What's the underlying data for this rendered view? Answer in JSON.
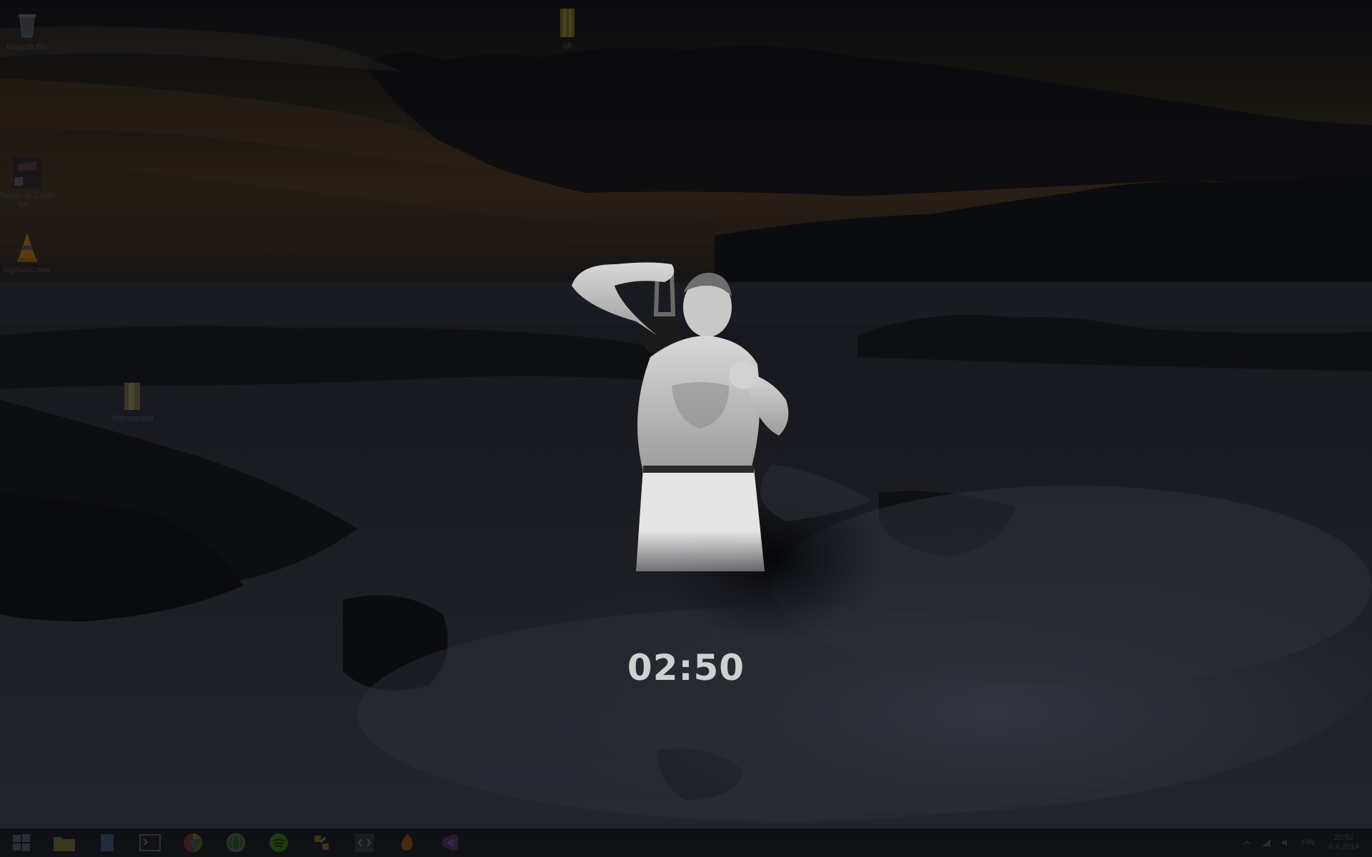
{
  "desktop": {
    "icons": [
      {
        "label": "Recycle Bin",
        "icon": "recycle-bin-icon"
      },
      {
        "label": "git",
        "icon": "folder-icon"
      },
      {
        "label": "Return to Castle Wo...",
        "icon": "game-shortcut-icon"
      },
      {
        "label": "bigmusic.wav",
        "icon": "vlc-icon"
      },
      {
        "label": "Rampanted",
        "icon": "folder-icon"
      }
    ]
  },
  "timer": {
    "value": "02:50"
  },
  "taskbar": {
    "apps": [
      {
        "name": "start",
        "icon": "windows-start-icon"
      },
      {
        "name": "file-explorer",
        "icon": "folder-icon"
      },
      {
        "name": "app-2",
        "icon": "document-icon"
      },
      {
        "name": "terminal",
        "icon": "terminal-icon"
      },
      {
        "name": "chrome",
        "icon": "chrome-icon"
      },
      {
        "name": "app-5",
        "icon": "globe-icon"
      },
      {
        "name": "spotify",
        "icon": "spotify-icon"
      },
      {
        "name": "app-7",
        "icon": "tools-icon"
      },
      {
        "name": "code-editor",
        "icon": "code-icon"
      },
      {
        "name": "app-9",
        "icon": "fire-icon"
      },
      {
        "name": "visual-studio",
        "icon": "visual-studio-icon"
      }
    ],
    "tray": {
      "language": "FIN",
      "time": "20:52",
      "date": "6.4.2014"
    }
  },
  "colors": {
    "timer_text": "#cfd0d2",
    "sky_dark": "#0c0d12",
    "sky_glow": "#3a2a1a",
    "water": "#1a1c22"
  }
}
